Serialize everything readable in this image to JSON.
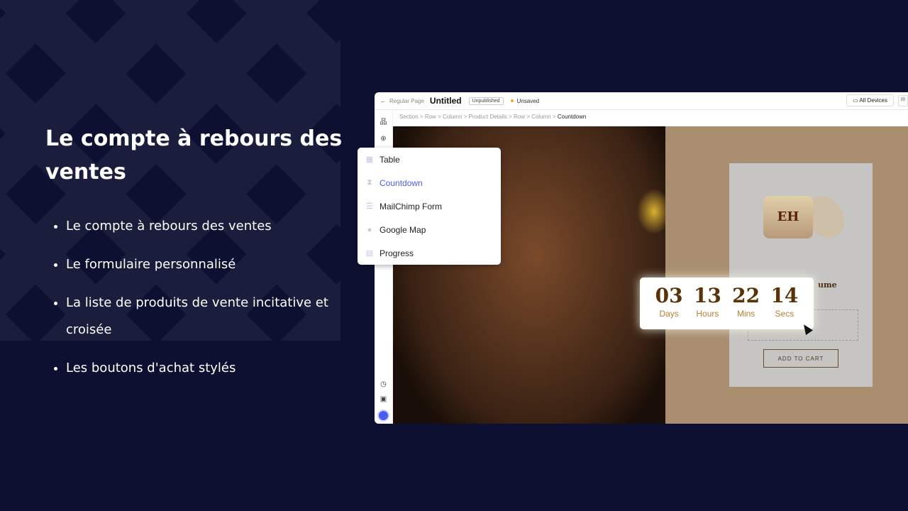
{
  "heading": "Le compte à rebours des ventes",
  "bullets": [
    "Le compte à rebours des ventes",
    "Le formulaire personnalisé",
    "La liste de produits de vente incitative et croisée",
    "Les boutons d'achat stylés"
  ],
  "editor": {
    "back_label": "Regular Page",
    "title": "Untitled",
    "status_badge": "Unpublished",
    "save_state": "Unsaved",
    "devices_label": "All Devices",
    "breadcrumbs": [
      "Section",
      "Row",
      "Column",
      "Product Details",
      "Row",
      "Column",
      "Countdown"
    ]
  },
  "menu": {
    "items": [
      {
        "label": "Table",
        "icon": "table-icon"
      },
      {
        "label": "Countdown",
        "icon": "hourglass-icon",
        "active": true
      },
      {
        "label": "MailChimp Form",
        "icon": "list-icon"
      },
      {
        "label": "Google Map",
        "icon": "map-pin-icon"
      },
      {
        "label": "Progress",
        "icon": "progress-icon"
      }
    ]
  },
  "product": {
    "logo": "EH",
    "name_fragment": "ume",
    "add_to_cart": "ADD TO CART"
  },
  "countdown": [
    {
      "value": "03",
      "unit": "Days"
    },
    {
      "value": "13",
      "unit": "Hours"
    },
    {
      "value": "22",
      "unit": "Mins"
    },
    {
      "value": "14",
      "unit": "Secs"
    }
  ],
  "colors": {
    "background": "#0d1030",
    "accent": "#4b5cf0",
    "countdown_number": "#5a3208",
    "countdown_label": "#b5803a"
  }
}
